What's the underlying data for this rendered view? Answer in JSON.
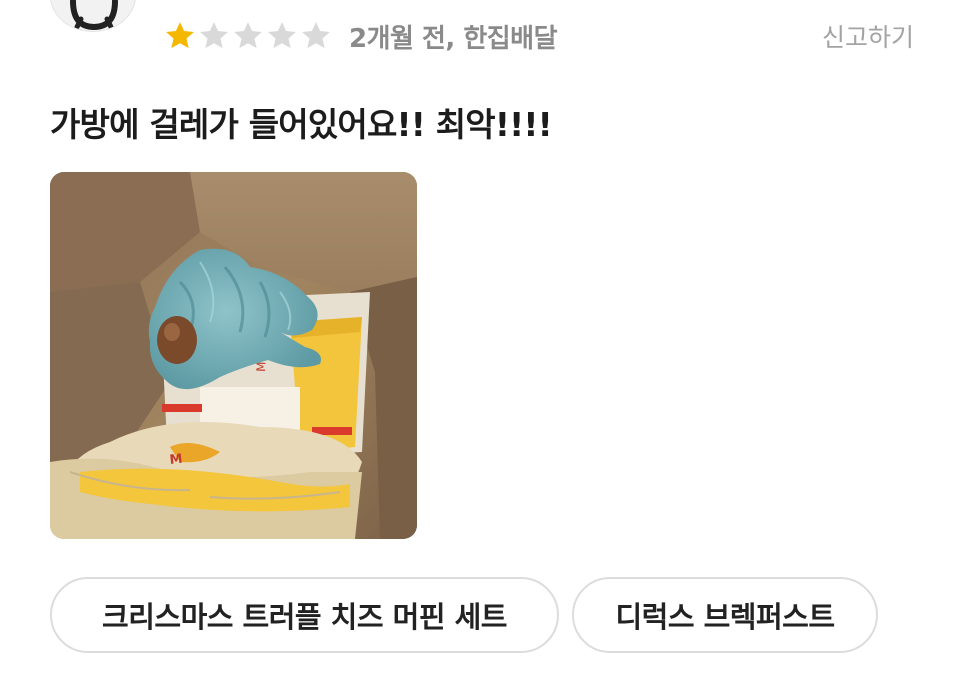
{
  "review": {
    "rating": 1,
    "rating_max": 5,
    "time_ago": "2개월 전, 한집배달",
    "report_label": "신고하기",
    "text": "가방에 걸레가 들어있어요!! 최악!!!!"
  },
  "icons": {
    "avatar": "user-avatar-icon",
    "star": "star-icon"
  },
  "colors": {
    "star_filled": "#F5B800",
    "star_empty": "#D9D9D9",
    "meta_text": "#8A8A8A",
    "report_text": "#A3A3A3",
    "chip_border": "#DCDCDC"
  },
  "menu_tags": [
    {
      "label": "크리스마스 트러플 치즈 머핀 세트"
    },
    {
      "label": "디럭스 브렉퍼스트"
    }
  ]
}
